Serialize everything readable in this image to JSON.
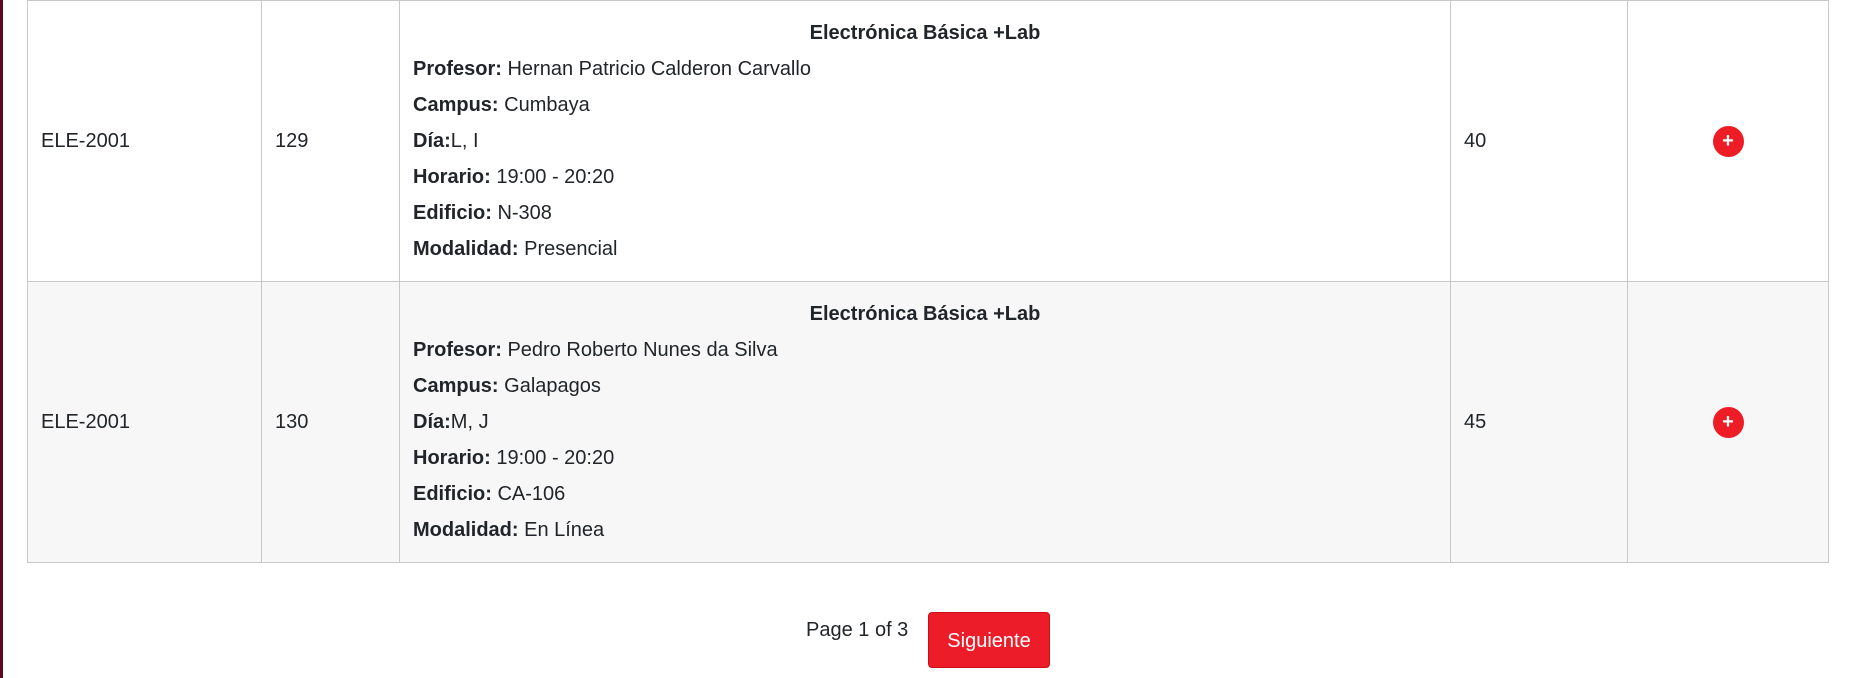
{
  "courses": [
    {
      "code": "ELE-2001",
      "nrc": "129",
      "title": "Electrónica Básica +Lab",
      "profesor_label": "Profesor:",
      "profesor": "Hernan Patricio Calderon Carvallo",
      "campus_label": "Campus:",
      "campus": "Cumbaya",
      "dia_label": "Día:",
      "dia": "L, I",
      "horario_label": "Horario:",
      "horario": "19:00 - 20:20",
      "edificio_label": "Edificio:",
      "edificio": "N-308",
      "modalidad_label": "Modalidad:",
      "modalidad": "Presencial",
      "cupos": "40",
      "add_icon": "+"
    },
    {
      "code": "ELE-2001",
      "nrc": "130",
      "title": "Electrónica Básica +Lab",
      "profesor_label": "Profesor:",
      "profesor": "Pedro Roberto Nunes da Silva",
      "campus_label": "Campus:",
      "campus": "Galapagos",
      "dia_label": "Día:",
      "dia": "M, J",
      "horario_label": "Horario:",
      "horario": "19:00 - 20:20",
      "edificio_label": "Edificio:",
      "edificio": "CA-106",
      "modalidad_label": "Modalidad:",
      "modalidad": "En Línea",
      "cupos": "45",
      "add_icon": "+"
    }
  ],
  "pagination": {
    "page_text": "Page 1 of 3",
    "next_label": "Siguiente"
  },
  "colors": {
    "accent": "#ec1c28",
    "left_strip": "#5c0a1e"
  }
}
